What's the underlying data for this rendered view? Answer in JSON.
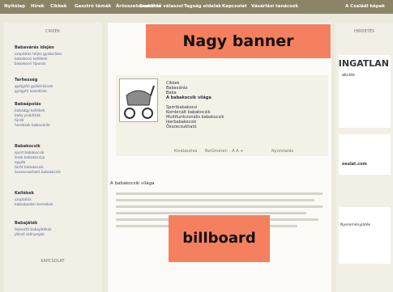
{
  "topnav": {
    "items": [
      "Nyitólap",
      "Hírek",
      "Cikkek",
      "Gasztró témák",
      "Árösszehasonlítás",
      "Szakértő válaszol",
      "Tagság oldalak",
      "Kapcsolat",
      "Vásárlási tanácsok",
      "A Családi képek"
    ]
  },
  "banners": {
    "nagy": "Nagy banner",
    "billboard": "billboard"
  },
  "left": {
    "header": "CIKKEK",
    "sections": [
      {
        "title": "Babavárás idején",
        "links": [
          "szoptatás teljes gyakorlata",
          "babakocsi kellékek",
          "babakocsi típusok"
        ]
      },
      {
        "title": "Terhesség",
        "links": [
          "gyógyító gyökérkövek",
          "gyógyfű kezelések"
        ]
      },
      {
        "title": "Babaápolás",
        "links": [
          "babaágy kellékek",
          "baby praktikák",
          "fürdő",
          "hordozók babavárók"
        ]
      },
      {
        "title": "Babakocsik",
        "links": [
          "sport babakocsik",
          "ikrek babakocsija",
          "egyéb",
          "túrát babakocsik",
          "összecsukható babakocsik"
        ]
      },
      {
        "title": "Kellékek",
        "links": [
          "szoptatás",
          "babaápolási termékek"
        ]
      },
      {
        "title": "Babajáték",
        "links": [
          "fejlesztő babajátékok",
          "játszó szőnyegek"
        ]
      }
    ],
    "footer": "KAPCSOLAT"
  },
  "right": {
    "header": "HIRDETÉS",
    "ad1_text": "INGATLAN",
    "ad1_sub": "akciós",
    "ad2_text": "osulat.com",
    "ad3_text": "Nyereményjáték"
  },
  "product": {
    "crumbs": [
      "Cikkek",
      "Babavárás",
      "Baba",
      "A babakocsik világa"
    ],
    "links": [
      "Sportbabakocsi",
      "Kombinált babakocsik",
      "Multifunkcionális babakocsik",
      "Ikerbabakocsik",
      "Összecsukható"
    ],
    "meta_left": "Kiválasztva",
    "meta_mid": "Betűméret: - A A +",
    "meta_right": "Nyomtatás"
  },
  "article": {
    "title": "A babakocsik világa"
  }
}
